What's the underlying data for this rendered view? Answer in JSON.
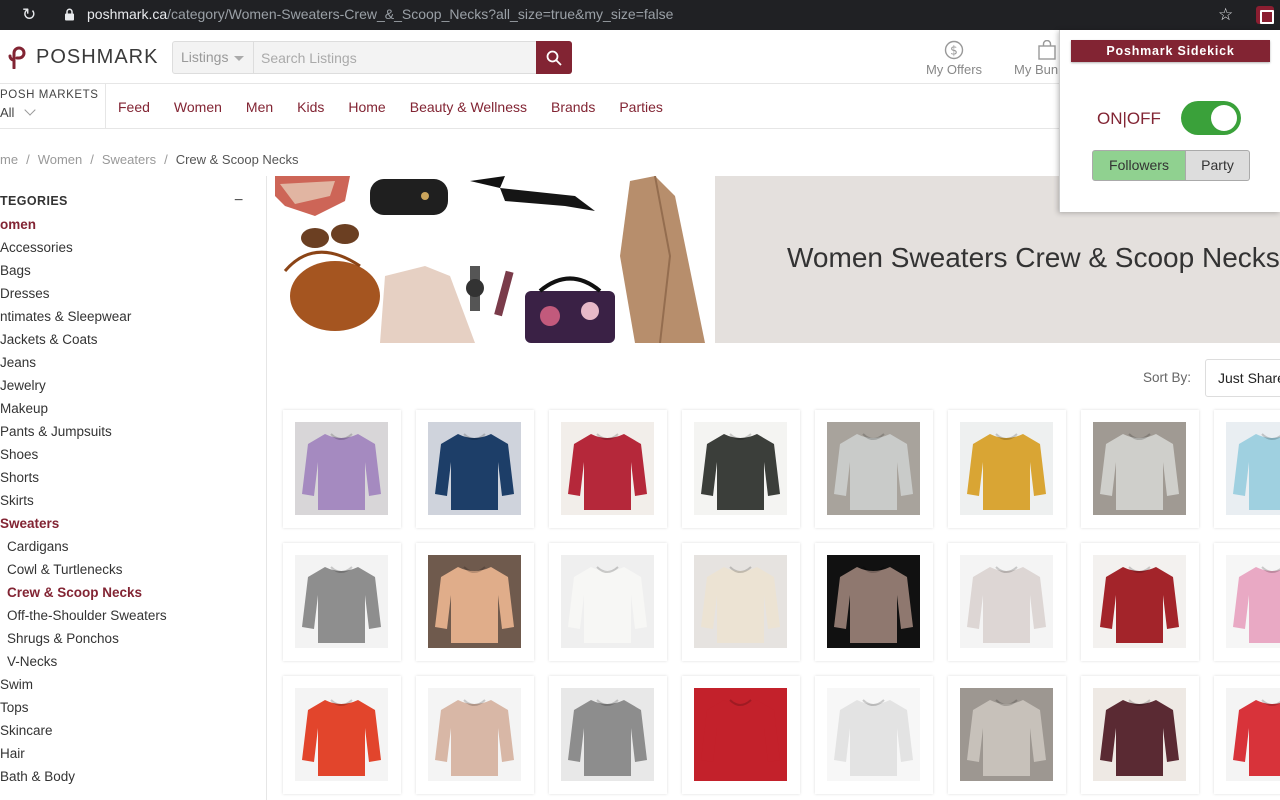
{
  "browser": {
    "url_domain": "poshmark.ca",
    "url_path": "/category/Women-Sweaters-Crew_&_Scoop_Necks?all_size=true&my_size=false"
  },
  "header": {
    "logo_text": "POSHMARK",
    "search_category": "Listings",
    "search_placeholder": "Search Listings",
    "offers_label": "My Offers",
    "bundles_label": "My Bun"
  },
  "nav": {
    "posh_markets_label": "POSH MARKETS",
    "posh_markets_value": "All",
    "links": [
      "Feed",
      "Women",
      "Men",
      "Kids",
      "Home",
      "Beauty & Wellness",
      "Brands",
      "Parties"
    ]
  },
  "breadcrumb": [
    "me",
    "Women",
    "Sweaters",
    "Crew & Scoop Necks"
  ],
  "sidebar": {
    "heading": "TEGORIES",
    "categories": [
      {
        "label": "omen",
        "type": "active"
      },
      {
        "label": "Accessories",
        "type": "normal"
      },
      {
        "label": "Bags",
        "type": "normal"
      },
      {
        "label": "Dresses",
        "type": "normal"
      },
      {
        "label": "ntimates & Sleepwear",
        "type": "normal"
      },
      {
        "label": "Jackets & Coats",
        "type": "normal"
      },
      {
        "label": "Jeans",
        "type": "normal"
      },
      {
        "label": "Jewelry",
        "type": "normal"
      },
      {
        "label": "Makeup",
        "type": "normal"
      },
      {
        "label": "Pants & Jumpsuits",
        "type": "normal"
      },
      {
        "label": "Shoes",
        "type": "normal"
      },
      {
        "label": "Shorts",
        "type": "normal"
      },
      {
        "label": "Skirts",
        "type": "normal"
      },
      {
        "label": "Sweaters",
        "type": "active"
      },
      {
        "label": "Cardigans",
        "type": "sub"
      },
      {
        "label": "Cowl & Turtlenecks",
        "type": "sub"
      },
      {
        "label": "Crew & Scoop Necks",
        "type": "sub-active"
      },
      {
        "label": "Off-the-Shoulder Sweaters",
        "type": "sub"
      },
      {
        "label": "Shrugs & Ponchos",
        "type": "sub"
      },
      {
        "label": "V-Necks",
        "type": "sub"
      },
      {
        "label": "Swim",
        "type": "normal"
      },
      {
        "label": "Tops",
        "type": "normal"
      },
      {
        "label": "Skincare",
        "type": "normal"
      },
      {
        "label": "Hair",
        "type": "normal"
      },
      {
        "label": "Bath & Body",
        "type": "normal"
      }
    ]
  },
  "banner": {
    "title": "Women Sweaters Crew & Scoop Necks"
  },
  "sort": {
    "label": "Sort By:",
    "value": "Just Shared"
  },
  "listings": [
    {
      "name": "listing-purple-sweater",
      "bg": "#d8d6d8",
      "sweater": "#a58ac0"
    },
    {
      "name": "listing-navy-sweater",
      "bg": "#cfd3dc",
      "sweater": "#1d3e68"
    },
    {
      "name": "listing-red-sweater",
      "bg": "#f2eeea",
      "sweater": "#b5283a"
    },
    {
      "name": "listing-black-knit-sweater",
      "bg": "#f4f4f2",
      "sweater": "#3b3e3a"
    },
    {
      "name": "listing-grey-striped-sweater",
      "bg": "#a8a39c",
      "sweater": "#c9cbc9"
    },
    {
      "name": "listing-mustard-sweater",
      "bg": "#eef0f0",
      "sweater": "#d9a534"
    },
    {
      "name": "listing-grey-stripe-sweater-2",
      "bg": "#a09a93",
      "sweater": "#cfcfcb"
    },
    {
      "name": "listing-light-blue-sweater",
      "bg": "#e9eef2",
      "sweater": "#9fd0e0"
    },
    {
      "name": "listing-grey-raglan-sweater",
      "bg": "#f3f3f3",
      "sweater": "#8e8e8e"
    },
    {
      "name": "listing-peach-vneck-sweater",
      "bg": "#6f5a4d",
      "sweater": "#e0ad8a"
    },
    {
      "name": "listing-white-sweater",
      "bg": "#efefef",
      "sweater": "#f7f7f5"
    },
    {
      "name": "listing-cream-cropped-sweater",
      "bg": "#e6e3e0",
      "sweater": "#ece3d3"
    },
    {
      "name": "listing-leopard-sweater",
      "bg": "#111111",
      "sweater": "#8f786f"
    },
    {
      "name": "listing-oatmeal-sweater",
      "bg": "#f4f4f4",
      "sweater": "#ddd6d4"
    },
    {
      "name": "listing-burgundy-sweater",
      "bg": "#f3f1ef",
      "sweater": "#a3242a"
    },
    {
      "name": "listing-rainbow-stripe-sweater",
      "bg": "#f6f6f6",
      "sweater": "#e9a9c4"
    },
    {
      "name": "listing-orange-red-sweater",
      "bg": "#f4f4f4",
      "sweater": "#e2452c"
    },
    {
      "name": "listing-peach-knit-sweater",
      "bg": "#f4f4f4",
      "sweater": "#d8b7a6"
    },
    {
      "name": "listing-heather-grey-sweater",
      "bg": "#e8e8e8",
      "sweater": "#8d8d8d"
    },
    {
      "name": "listing-holiday-sweater",
      "bg": "#c3212b",
      "sweater": "#c3212b"
    },
    {
      "name": "listing-black-white-stripe-sweater",
      "bg": "#f7f7f7",
      "sweater": "#e3e3e3"
    },
    {
      "name": "listing-taupe-sweater",
      "bg": "#9d9791",
      "sweater": "#c7c1ba"
    },
    {
      "name": "listing-maroon-knit-sweater",
      "bg": "#eee9e4",
      "sweater": "#5a2a33"
    },
    {
      "name": "listing-coral-sweater",
      "bg": "#f4f4f4",
      "sweater": "#d8333a"
    }
  ],
  "sidekick": {
    "title": "Poshmark Sidekick",
    "onoff_label": "ON|OFF",
    "toggle_on": true,
    "tab_followers": "Followers",
    "tab_party": "Party"
  },
  "colors": {
    "brand": "#822433",
    "toggle_on": "#3aa13a",
    "tab_active": "#90d190"
  }
}
